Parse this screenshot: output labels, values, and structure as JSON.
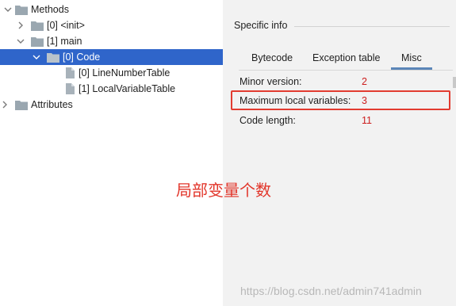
{
  "tree": {
    "nodes": [
      {
        "label": "Methods",
        "expanded": true
      },
      {
        "label": "[0] <init>",
        "expanded": false
      },
      {
        "label": "[1] main",
        "expanded": true
      },
      {
        "label": "[0] Code",
        "expanded": true,
        "selected": true
      },
      {
        "label": "[0] LineNumberTable"
      },
      {
        "label": "[1] LocalVariableTable"
      },
      {
        "label": "Attributes",
        "expanded": false
      }
    ]
  },
  "panel": {
    "section_title": "Specific info",
    "tabs": [
      {
        "label": "Bytecode"
      },
      {
        "label": "Exception table"
      },
      {
        "label": "Misc",
        "active": true
      }
    ],
    "fields": [
      {
        "label": "Minor version:",
        "value": "2"
      },
      {
        "label": "Maximum local variables:",
        "value": "3"
      },
      {
        "label": "Code length:",
        "value": "11"
      }
    ]
  },
  "annotation": {
    "text": "局部变量个数",
    "color": "#e2362b"
  },
  "watermark": "https://blog.csdn.net/admin741admin",
  "colors": {
    "selection": "#2f65ca",
    "value": "#cc1e1e",
    "highlight_box": "#e23b30",
    "panel_bg": "#f2f2f2"
  },
  "icons": {
    "folder": "folder-icon",
    "file": "document-icon",
    "expanded": "chevron-down-icon",
    "collapsed": "chevron-right-icon"
  }
}
